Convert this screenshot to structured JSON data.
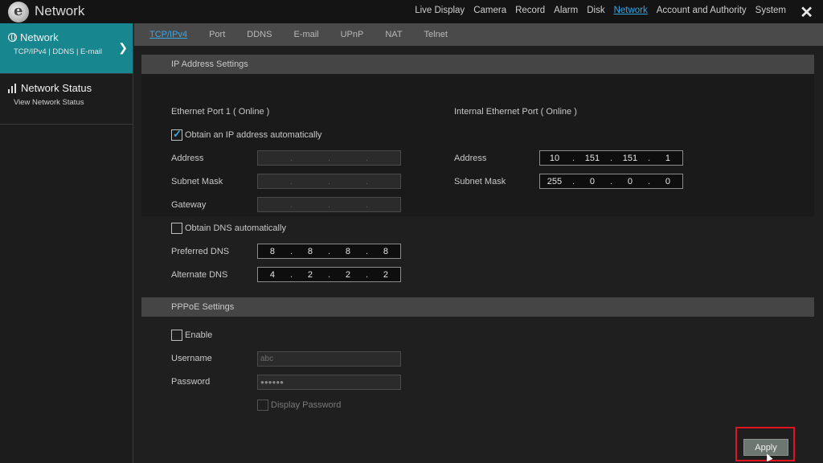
{
  "header": {
    "title": "Network",
    "nav": [
      "Live Display",
      "Camera",
      "Record",
      "Alarm",
      "Disk",
      "Network",
      "Account and Authority",
      "System"
    ],
    "active_nav": "Network",
    "close_symbol": "✕"
  },
  "sidebar": {
    "items": [
      {
        "title": "Network",
        "sub": "TCP/IPv4 | DDNS | E-mail",
        "icon": "globe-icon",
        "active": true
      },
      {
        "title": "Network Status",
        "sub": "View Network Status",
        "icon": "signal-bars-icon",
        "active": false
      }
    ]
  },
  "tabs": [
    "TCP/IPv4",
    "Port",
    "DDNS",
    "E-mail",
    "UPnP",
    "NAT",
    "Telnet"
  ],
  "active_tab": "TCP/IPv4",
  "ip_settings": {
    "section_title": "IP Address Settings",
    "eth1_title": "Ethernet Port 1 ( Online )",
    "internal_title": "Internal Ethernet Port ( Online )",
    "obtain_ip_label": "Obtain an IP address automatically",
    "obtain_ip_checked": true,
    "address_label": "Address",
    "subnet_label": "Subnet Mask",
    "gateway_label": "Gateway",
    "obtain_dns_label": "Obtain DNS automatically",
    "obtain_dns_checked": false,
    "preferred_dns_label": "Preferred DNS",
    "alternate_dns_label": "Alternate DNS",
    "preferred_dns": [
      "8",
      "8",
      "8",
      "8"
    ],
    "alternate_dns": [
      "4",
      "2",
      "2",
      "2"
    ],
    "internal_address": [
      "10",
      "151",
      "151",
      "1"
    ],
    "internal_subnet": [
      "255",
      "0",
      "0",
      "0"
    ]
  },
  "pppoe": {
    "section_title": "PPPoE Settings",
    "enable_label": "Enable",
    "username_label": "Username",
    "username_value": "abc",
    "password_label": "Password",
    "password_value": "●●●●●●",
    "display_password_label": "Display Password"
  },
  "apply_label": "Apply",
  "colors": {
    "accent": "#3aa6e6",
    "sidebar_active": "#17868f",
    "highlight_frame": "#e0141e"
  }
}
